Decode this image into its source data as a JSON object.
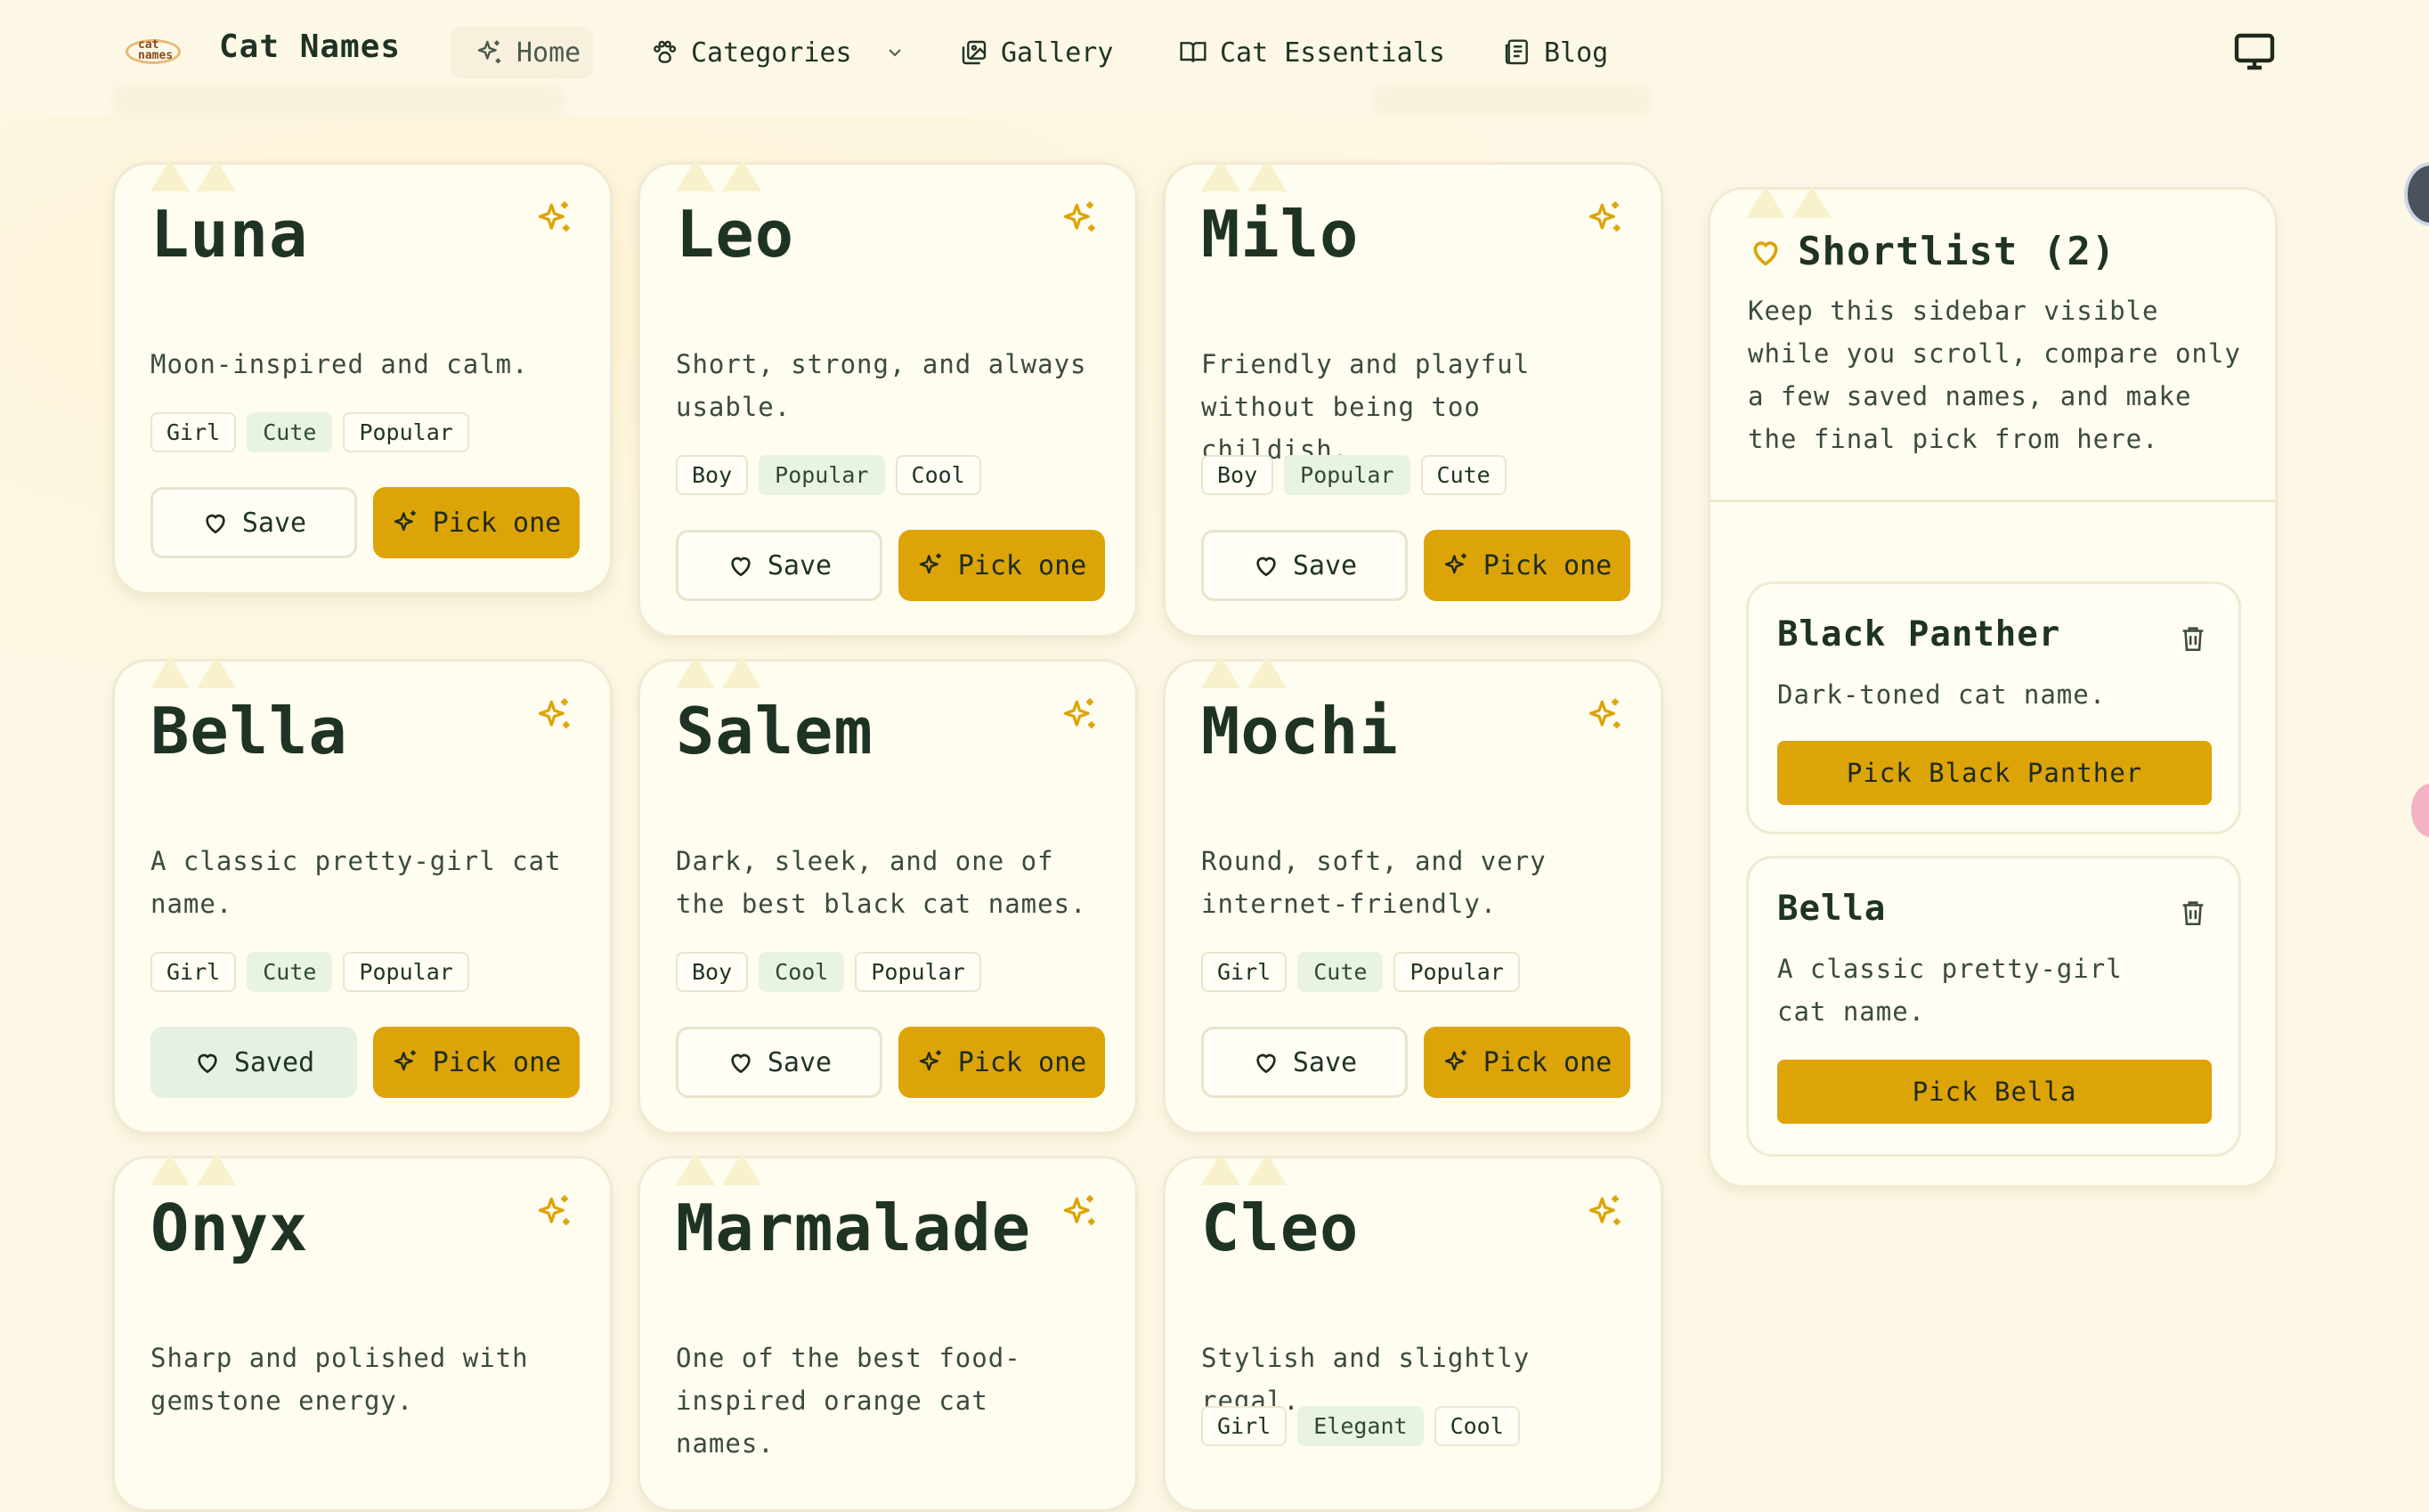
{
  "colors": {
    "accent": "#dca406",
    "background": "#fdf8e6",
    "card": "#fffcf0",
    "text": "#1f3324",
    "saved": "#e5f1e2",
    "tag_green": "#e9f3e4"
  },
  "logo": {
    "text": "cat names"
  },
  "brand": "Cat Names",
  "nav": [
    {
      "label": "Home",
      "icon": "sparkle-icon"
    },
    {
      "label": "Categories",
      "icon": "paw-icon"
    },
    {
      "label": "Gallery",
      "icon": "image-icon"
    },
    {
      "label": "Cat Essentials",
      "icon": "book-open-icon"
    },
    {
      "label": "Blog",
      "icon": "newspaper-icon"
    }
  ],
  "cards": [
    {
      "name": "Luna",
      "desc": "Moon-inspired and calm.",
      "tags": [
        "Girl",
        "Cute",
        "Popular"
      ],
      "save": "Save",
      "pick": "Pick one"
    },
    {
      "name": "Leo",
      "desc": "Short, strong, and always usable.",
      "tags": [
        "Boy",
        "Popular",
        "Cool"
      ],
      "save": "Save",
      "pick": "Pick one"
    },
    {
      "name": "Milo",
      "desc": "Friendly and playful without being too childish.",
      "tags": [
        "Boy",
        "Popular",
        "Cute"
      ],
      "save": "Save",
      "pick": "Pick one"
    },
    {
      "name": "Bella",
      "desc": "A classic pretty-girl cat name.",
      "tags": [
        "Girl",
        "Cute",
        "Popular"
      ],
      "save": "Saved",
      "pick": "Pick one"
    },
    {
      "name": "Salem",
      "desc": "Dark, sleek, and one of the best black cat names.",
      "tags": [
        "Boy",
        "Cool",
        "Popular"
      ],
      "save": "Save",
      "pick": "Pick one"
    },
    {
      "name": "Mochi",
      "desc": "Round, soft, and very internet-friendly.",
      "tags": [
        "Girl",
        "Cute",
        "Popular"
      ],
      "save": "Save",
      "pick": "Pick one"
    },
    {
      "name": "Onyx",
      "desc": "Sharp and polished with gemstone energy."
    },
    {
      "name": "Marmalade",
      "desc": "One of the best food-inspired orange cat names."
    },
    {
      "name": "Cleo",
      "desc": "Stylish and slightly regal.",
      "tags": [
        "Girl",
        "Elegant",
        "Cool"
      ]
    }
  ],
  "shortlist": {
    "title": "Shortlist (2)",
    "desc": "Keep this sidebar visible while you scroll, compare only a few saved names, and make the final pick from here.",
    "items": [
      {
        "name": "Black Panther",
        "desc": "Dark-toned cat name.",
        "pick": "Pick Black Panther"
      },
      {
        "name": "Bella",
        "desc": "A classic pretty-girl cat name.",
        "pick": "Pick Bella"
      }
    ]
  }
}
